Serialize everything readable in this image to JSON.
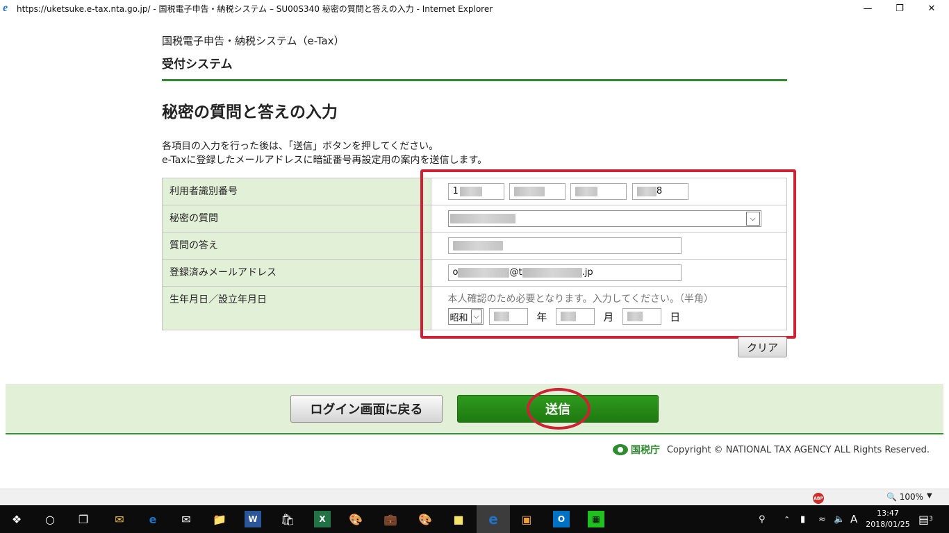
{
  "window": {
    "title": "https://uketsuke.e-tax.nta.go.jp/ - 国税電子申告・納税システム – SU00S340 秘密の質問と答えの入力 - Internet Explorer",
    "minimize": "—",
    "restore": "❐",
    "close": "✕"
  },
  "header": {
    "system_name": "国税電子申告・納税システム（e-Tax）",
    "subsystem": "受付システム"
  },
  "main": {
    "title": "秘密の質問と答えの入力",
    "description_1": "各項目の入力を行った後は、「送信」ボタンを押してください。",
    "description_2": "e-Taxに登録したメールアドレスに暗証番号再設定用の案内を送信します。"
  },
  "form": {
    "user_id": {
      "label": "利用者識別番号",
      "part1": "1",
      "part2": "",
      "part3": "",
      "part4": "8"
    },
    "secret_question": {
      "label": "秘密の質問"
    },
    "answer": {
      "label": "質問の答え"
    },
    "email": {
      "label": "登録済みメールアドレス",
      "prefix": "o",
      "at": "@t",
      "suffix": ".jp"
    },
    "birth": {
      "label": "生年月日／設立年月日",
      "note": "本人確認のため必要となります。入力してください。（半角）",
      "era": "昭和",
      "year_unit": "年",
      "month_unit": "月",
      "day_unit": "日"
    },
    "clear_button": "クリア"
  },
  "actions": {
    "back_button": "ログイン画面に戻る",
    "send_button": "送信"
  },
  "footer": {
    "agency": "国税庁",
    "copyright": "Copyright © NATIONAL TAX AGENCY ALL Rights Reserved."
  },
  "statusbar": {
    "abp": "ABP",
    "zoom": "100%"
  },
  "taskbar": {
    "ime": "A",
    "time": "13:47",
    "date": "2018/01/25",
    "notifications": "3"
  }
}
